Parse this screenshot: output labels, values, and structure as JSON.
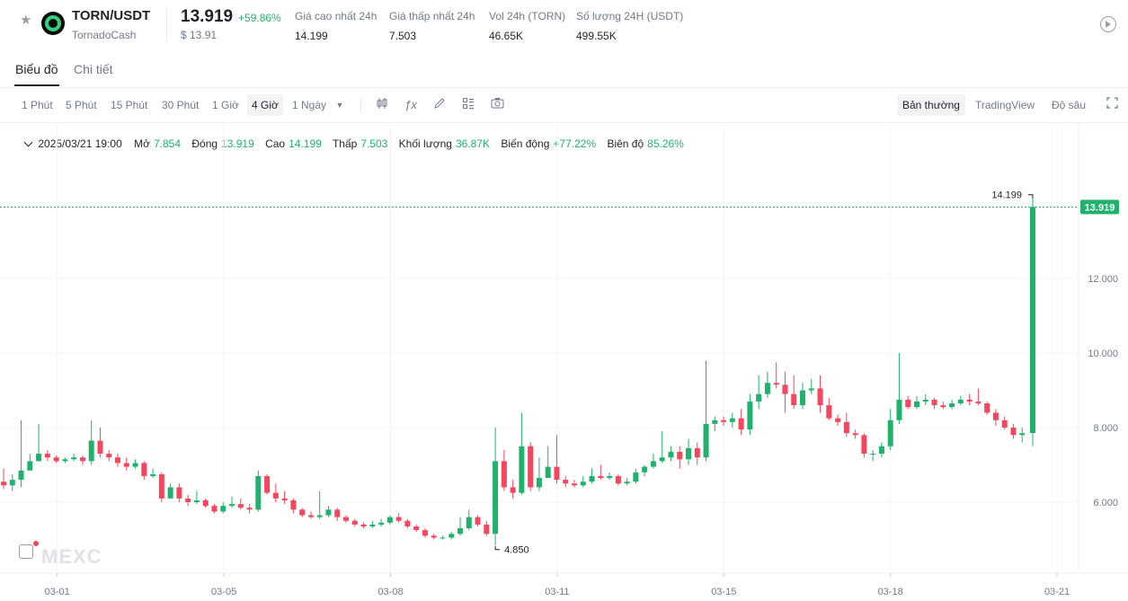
{
  "header": {
    "pair": "TORN/USDT",
    "project": "TornadoCash",
    "price": "13.919",
    "change": "+59.86%",
    "usd_price": "$ 13.91",
    "stats": [
      {
        "label": "Giá cao nhất 24h",
        "value": "14.199"
      },
      {
        "label": "Giá thấp nhất 24h",
        "value": "7.503"
      },
      {
        "label": "Vol 24h (TORN)",
        "value": "46.65K"
      },
      {
        "label": "Số lượng 24H (USDT)",
        "value": "499.55K"
      }
    ],
    "icons": {
      "favorite": "star-icon",
      "logo": "tornado-cash-logo",
      "replay": "play-circle-icon"
    }
  },
  "tabs": [
    {
      "label": "Biểu đồ",
      "active": true
    },
    {
      "label": "Chi tiết",
      "active": false
    }
  ],
  "toolbar": {
    "timeframes": [
      "1 Phút",
      "5 Phút",
      "15 Phút",
      "30 Phút",
      "1 Giờ",
      "4 Giờ",
      "1 Ngày"
    ],
    "active_timeframe": "4 Giờ",
    "tools": [
      "candlestick-icon",
      "fx-indicator-icon",
      "pencil-icon",
      "layout-icon",
      "camera-icon"
    ],
    "views": [
      "Bản thường",
      "TradingView",
      "Độ sâu"
    ],
    "active_view": "Bản thường",
    "fullscreen_icon": "fullscreen-icon"
  },
  "ohlc": {
    "date": "2025/03/21 19:00",
    "open_label": "Mở",
    "open": "7.854",
    "close_label": "Đóng",
    "close": "13.919",
    "high_label": "Cao",
    "high": "14.199",
    "low_label": "Thấp",
    "low": "7.503",
    "volume_label": "Khối lượng",
    "volume": "36.87K",
    "change_label": "Biến động",
    "change": "+77.22%",
    "amplitude_label": "Biên độ",
    "amplitude": "85.26%"
  },
  "watermark": "MEXC",
  "chart_data": {
    "type": "candlestick",
    "up_color": "#20b26c",
    "down_color": "#f6465d",
    "y_ticks": [
      "6.000",
      "8.000",
      "10.000",
      "12.000"
    ],
    "y_tick_values": [
      6,
      8,
      10,
      12
    ],
    "ylim": [
      4.0,
      16.0
    ],
    "x_ticks": [
      "03-01",
      "03-05",
      "03-08",
      "03-11",
      "03-15",
      "03-18",
      "03-21"
    ],
    "x_tick_candle_index": [
      4,
      27,
      50,
      73,
      96,
      119,
      142
    ],
    "current_price": "13.919",
    "current_price_value": 13.919,
    "max_label": "14.199",
    "max_value": 14.199,
    "min_label": "4.850",
    "min_value": 4.85,
    "candles": [
      [
        6.55,
        6.45,
        6.9,
        6.35
      ],
      [
        6.45,
        6.6,
        6.75,
        6.3
      ],
      [
        6.6,
        6.85,
        8.2,
        6.4
      ],
      [
        6.85,
        7.1,
        7.3,
        6.9
      ],
      [
        7.1,
        7.3,
        8.1,
        7.1
      ],
      [
        7.3,
        7.2,
        7.4,
        7.1
      ],
      [
        7.2,
        7.1,
        7.25,
        7.05
      ],
      [
        7.1,
        7.15,
        7.2,
        7.05
      ],
      [
        7.15,
        7.2,
        7.3,
        7.1
      ],
      [
        7.2,
        7.1,
        7.25,
        7.0
      ],
      [
        7.1,
        7.65,
        8.2,
        7.0
      ],
      [
        7.65,
        7.3,
        8.0,
        7.2
      ],
      [
        7.3,
        7.2,
        7.4,
        7.1
      ],
      [
        7.2,
        7.05,
        7.3,
        6.95
      ],
      [
        7.05,
        6.95,
        7.2,
        6.85
      ],
      [
        6.95,
        7.05,
        7.15,
        6.9
      ],
      [
        7.05,
        6.7,
        7.1,
        6.6
      ],
      [
        6.7,
        6.75,
        6.9,
        6.65
      ],
      [
        6.75,
        6.1,
        6.8,
        6.0
      ],
      [
        6.1,
        6.4,
        6.5,
        6.1
      ],
      [
        6.4,
        6.1,
        6.5,
        6.0
      ],
      [
        6.1,
        6.0,
        6.2,
        5.9
      ],
      [
        6.0,
        6.05,
        6.3,
        5.95
      ],
      [
        6.05,
        5.9,
        6.1,
        5.85
      ],
      [
        5.9,
        5.75,
        5.95,
        5.7
      ],
      [
        5.75,
        5.9,
        6.0,
        5.7
      ],
      [
        5.9,
        5.95,
        6.15,
        5.85
      ],
      [
        5.95,
        5.85,
        6.1,
        5.8
      ],
      [
        5.85,
        5.8,
        5.95,
        5.7
      ],
      [
        5.8,
        6.7,
        6.85,
        5.75
      ],
      [
        6.7,
        6.25,
        6.75,
        6.2
      ],
      [
        6.25,
        6.1,
        6.5,
        6.0
      ],
      [
        6.1,
        6.05,
        6.3,
        5.95
      ],
      [
        6.05,
        5.8,
        6.1,
        5.7
      ],
      [
        5.8,
        5.65,
        5.85,
        5.6
      ],
      [
        5.65,
        5.6,
        5.75,
        5.55
      ],
      [
        5.6,
        5.65,
        6.3,
        5.55
      ],
      [
        5.65,
        5.8,
        5.9,
        5.6
      ],
      [
        5.8,
        5.6,
        5.85,
        5.5
      ],
      [
        5.6,
        5.5,
        5.65,
        5.45
      ],
      [
        5.5,
        5.4,
        5.55,
        5.35
      ],
      [
        5.4,
        5.35,
        5.45,
        5.3
      ],
      [
        5.35,
        5.4,
        5.5,
        5.3
      ],
      [
        5.4,
        5.45,
        5.55,
        5.35
      ],
      [
        5.45,
        5.6,
        5.65,
        5.4
      ],
      [
        5.6,
        5.5,
        5.7,
        5.45
      ],
      [
        5.5,
        5.35,
        5.55,
        5.3
      ],
      [
        5.35,
        5.25,
        5.4,
        5.2
      ],
      [
        5.25,
        5.1,
        5.3,
        5.05
      ],
      [
        5.1,
        5.05,
        5.15,
        5.0
      ],
      [
        5.05,
        5.05,
        5.1,
        5.0
      ],
      [
        5.05,
        5.15,
        5.2,
        5.0
      ],
      [
        5.15,
        5.3,
        5.6,
        5.1
      ],
      [
        5.3,
        5.6,
        5.8,
        5.25
      ],
      [
        5.6,
        5.4,
        5.65,
        5.35
      ],
      [
        5.4,
        5.15,
        5.5,
        5.1
      ],
      [
        5.15,
        7.1,
        8.0,
        4.85
      ],
      [
        7.1,
        6.4,
        7.4,
        6.3
      ],
      [
        6.4,
        6.25,
        6.6,
        6.1
      ],
      [
        6.25,
        7.5,
        8.4,
        6.2
      ],
      [
        7.5,
        6.4,
        7.6,
        6.3
      ],
      [
        6.4,
        6.65,
        7.2,
        6.3
      ],
      [
        6.65,
        6.95,
        7.5,
        6.8
      ],
      [
        6.95,
        6.6,
        7.8,
        6.5
      ],
      [
        6.6,
        6.5,
        6.7,
        6.4
      ],
      [
        6.5,
        6.45,
        6.6,
        6.4
      ],
      [
        6.45,
        6.55,
        6.7,
        6.4
      ],
      [
        6.55,
        6.7,
        6.9,
        6.5
      ],
      [
        6.7,
        6.65,
        7.0,
        6.6
      ],
      [
        6.65,
        6.7,
        6.8,
        6.6
      ],
      [
        6.7,
        6.5,
        6.75,
        6.45
      ],
      [
        6.5,
        6.55,
        6.65,
        6.45
      ],
      [
        6.55,
        6.8,
        6.9,
        6.5
      ],
      [
        6.8,
        6.95,
        7.0,
        6.7
      ],
      [
        6.95,
        7.1,
        7.3,
        6.9
      ],
      [
        7.1,
        7.2,
        7.9,
        7.05
      ],
      [
        7.2,
        7.35,
        7.5,
        7.1
      ],
      [
        7.35,
        7.15,
        7.5,
        6.9
      ],
      [
        7.15,
        7.45,
        7.7,
        7.0
      ],
      [
        7.45,
        7.2,
        7.6,
        7.0
      ],
      [
        7.2,
        8.1,
        9.8,
        7.1
      ],
      [
        8.1,
        8.2,
        8.3,
        7.9
      ],
      [
        8.2,
        8.15,
        8.3,
        8.05
      ],
      [
        8.15,
        8.25,
        8.4,
        8.0
      ],
      [
        8.25,
        7.95,
        8.5,
        7.8
      ],
      [
        7.95,
        8.7,
        8.9,
        7.8
      ],
      [
        8.7,
        8.9,
        9.4,
        8.5
      ],
      [
        8.9,
        9.2,
        9.5,
        8.8
      ],
      [
        9.2,
        9.15,
        9.75,
        9.05
      ],
      [
        9.15,
        8.9,
        9.5,
        8.4
      ],
      [
        8.9,
        8.6,
        9.4,
        8.5
      ],
      [
        8.6,
        9.0,
        9.2,
        8.5
      ],
      [
        9.0,
        9.05,
        9.3,
        8.9
      ],
      [
        9.05,
        8.6,
        9.4,
        8.4
      ],
      [
        8.6,
        8.25,
        8.8,
        8.2
      ],
      [
        8.25,
        8.15,
        8.35,
        8.05
      ],
      [
        8.15,
        7.85,
        8.4,
        7.75
      ],
      [
        7.85,
        7.8,
        7.95,
        7.7
      ],
      [
        7.8,
        7.3,
        7.85,
        7.2
      ],
      [
        7.3,
        7.3,
        7.4,
        7.1
      ],
      [
        7.3,
        7.5,
        7.6,
        7.2
      ],
      [
        7.5,
        8.2,
        8.5,
        7.4
      ],
      [
        8.2,
        8.75,
        10.0,
        8.1
      ],
      [
        8.75,
        8.55,
        8.85,
        8.5
      ],
      [
        8.55,
        8.7,
        8.85,
        8.5
      ],
      [
        8.7,
        8.75,
        8.9,
        8.6
      ],
      [
        8.75,
        8.6,
        8.8,
        8.5
      ],
      [
        8.6,
        8.55,
        8.7,
        8.5
      ],
      [
        8.55,
        8.65,
        8.75,
        8.5
      ],
      [
        8.65,
        8.75,
        8.85,
        8.6
      ],
      [
        8.75,
        8.7,
        8.9,
        8.6
      ],
      [
        8.7,
        8.65,
        9.05,
        8.6
      ],
      [
        8.65,
        8.4,
        8.7,
        8.35
      ],
      [
        8.4,
        8.2,
        8.5,
        8.05
      ],
      [
        8.2,
        8.0,
        8.3,
        7.95
      ],
      [
        8.0,
        7.8,
        8.1,
        7.7
      ],
      [
        7.8,
        7.85,
        8.0,
        7.6
      ],
      [
        7.854,
        13.919,
        14.199,
        7.503
      ]
    ]
  }
}
